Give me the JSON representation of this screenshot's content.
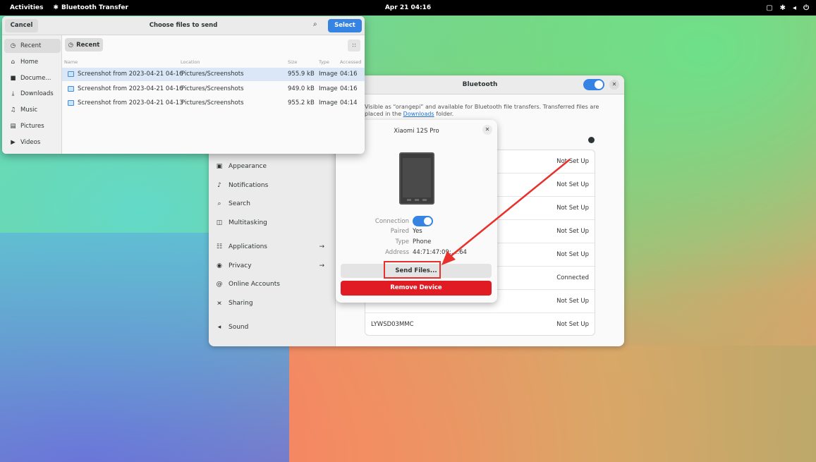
{
  "topbar": {
    "activities": "Activities",
    "app_name": "Bluetooth Transfer",
    "clock": "Apr 21 04:16"
  },
  "chooser": {
    "cancel": "Cancel",
    "title": "Choose files to send",
    "select": "Select",
    "path_button": "Recent",
    "places": [
      {
        "icon": "clock-icon",
        "label": "Recent"
      },
      {
        "icon": "home-icon",
        "label": "Home"
      },
      {
        "icon": "document-icon",
        "label": "Docume..."
      },
      {
        "icon": "download-icon",
        "label": "Downloads"
      },
      {
        "icon": "music-icon",
        "label": "Music"
      },
      {
        "icon": "pictures-icon",
        "label": "Pictures"
      },
      {
        "icon": "videos-icon",
        "label": "Videos"
      }
    ],
    "columns": {
      "name": "Name",
      "location": "Location",
      "size": "Size",
      "type": "Type",
      "accessed": "Accessed"
    },
    "files": [
      {
        "name": "Screenshot from 2023-04-21 04-16",
        "location": "Pictures/Screenshots",
        "size": "955.9 kB",
        "type": "Image",
        "accessed": "04:16",
        "selected": true
      },
      {
        "name": "Screenshot from 2023-04-21 04-16",
        "location": "Pictures/Screenshots",
        "size": "949.0 kB",
        "type": "Image",
        "accessed": "04:16",
        "selected": false
      },
      {
        "name": "Screenshot from 2023-04-21 04-13",
        "location": "Pictures/Screenshots",
        "size": "955.2 kB",
        "type": "Image",
        "accessed": "04:14",
        "selected": false
      }
    ]
  },
  "settings": {
    "title": "Bluetooth",
    "description_1": "Visible as “orangepi” and available for Bluetooth file transfers. Transferred files are",
    "description_2_prefix": "placed in the ",
    "description_link": "Downloads",
    "description_2_suffix": " folder.",
    "nav": [
      {
        "icon": "appearance-icon",
        "label": "Appearance",
        "arrow": false
      },
      {
        "icon": "notifications-icon",
        "label": "Notifications",
        "arrow": false
      },
      {
        "icon": "search-icon",
        "label": "Search",
        "arrow": false
      },
      {
        "icon": "multitasking-icon",
        "label": "Multitasking",
        "arrow": false
      },
      {
        "icon": "applications-icon",
        "label": "Applications",
        "arrow": true
      },
      {
        "icon": "privacy-icon",
        "label": "Privacy",
        "arrow": true
      },
      {
        "icon": "online-accounts-icon",
        "label": "Online Accounts",
        "arrow": false
      },
      {
        "icon": "sharing-icon",
        "label": "Sharing",
        "arrow": false
      },
      {
        "icon": "sound-icon",
        "label": "Sound",
        "arrow": false
      }
    ],
    "devices": [
      {
        "name": "",
        "status": "Not Set Up"
      },
      {
        "name": "",
        "status": "Not Set Up"
      },
      {
        "name": "",
        "status": "Not Set Up"
      },
      {
        "name": "",
        "status": "Not Set Up"
      },
      {
        "name": "",
        "status": "Not Set Up"
      },
      {
        "name": "",
        "status": "Connected"
      },
      {
        "name": "",
        "status": "Not Set Up"
      },
      {
        "name": "LYWSD03MMC",
        "status": "Not Set Up"
      }
    ]
  },
  "device_dialog": {
    "title": "Xiaomi 12S Pro",
    "connection_label": "Connection",
    "paired_label": "Paired",
    "paired_value": "Yes",
    "type_label": "Type",
    "type_value": "Phone",
    "address_label": "Address",
    "address_value": "44:71:47:09:…:64",
    "send_files": "Send Files...",
    "remove_device": "Remove Device"
  },
  "colors": {
    "accent": "#3584e4",
    "destructive": "#e01b24",
    "annotation": "#e8302c"
  }
}
